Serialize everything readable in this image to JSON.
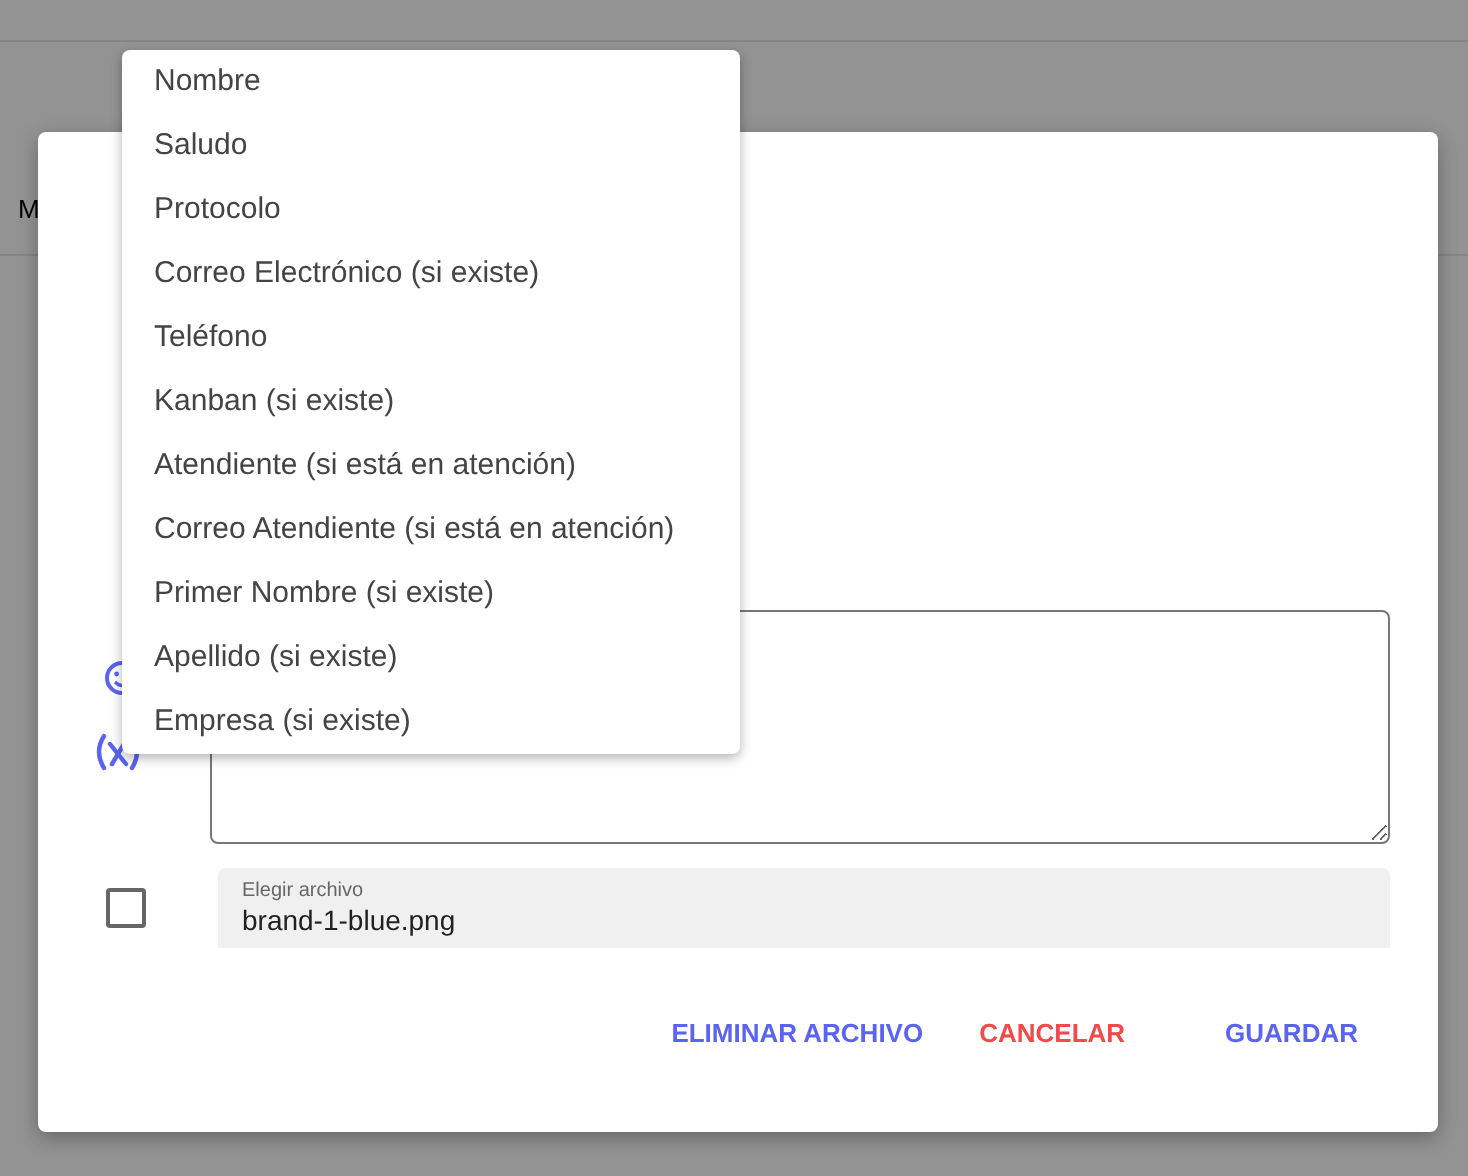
{
  "background": {
    "tab_label": "M"
  },
  "dialog": {
    "attachment_checkbox": {
      "checked": false
    },
    "file_field": {
      "label": "Elegir archivo",
      "value": "brand-1-blue.png"
    },
    "buttons": [
      {
        "label": "ELIMINAR ARCHIVO",
        "kind": "primary"
      },
      {
        "label": "CANCELAR",
        "kind": "danger"
      },
      {
        "label": "GUARDAR",
        "kind": "primary"
      }
    ]
  },
  "variable_menu": {
    "items": [
      {
        "label": "Nombre"
      },
      {
        "label": "Saludo"
      },
      {
        "label": "Protocolo"
      },
      {
        "label": "Correo Electrónico (si existe)"
      },
      {
        "label": "Teléfono"
      },
      {
        "label": "Kanban (si existe)"
      },
      {
        "label": "Atendiente (si está en atención)"
      },
      {
        "label": "Correo Atendiente (si está en atención)"
      },
      {
        "label": "Primer Nombre (si existe)"
      },
      {
        "label": "Apellido (si existe)"
      },
      {
        "label": "Empresa (si existe)"
      }
    ]
  }
}
